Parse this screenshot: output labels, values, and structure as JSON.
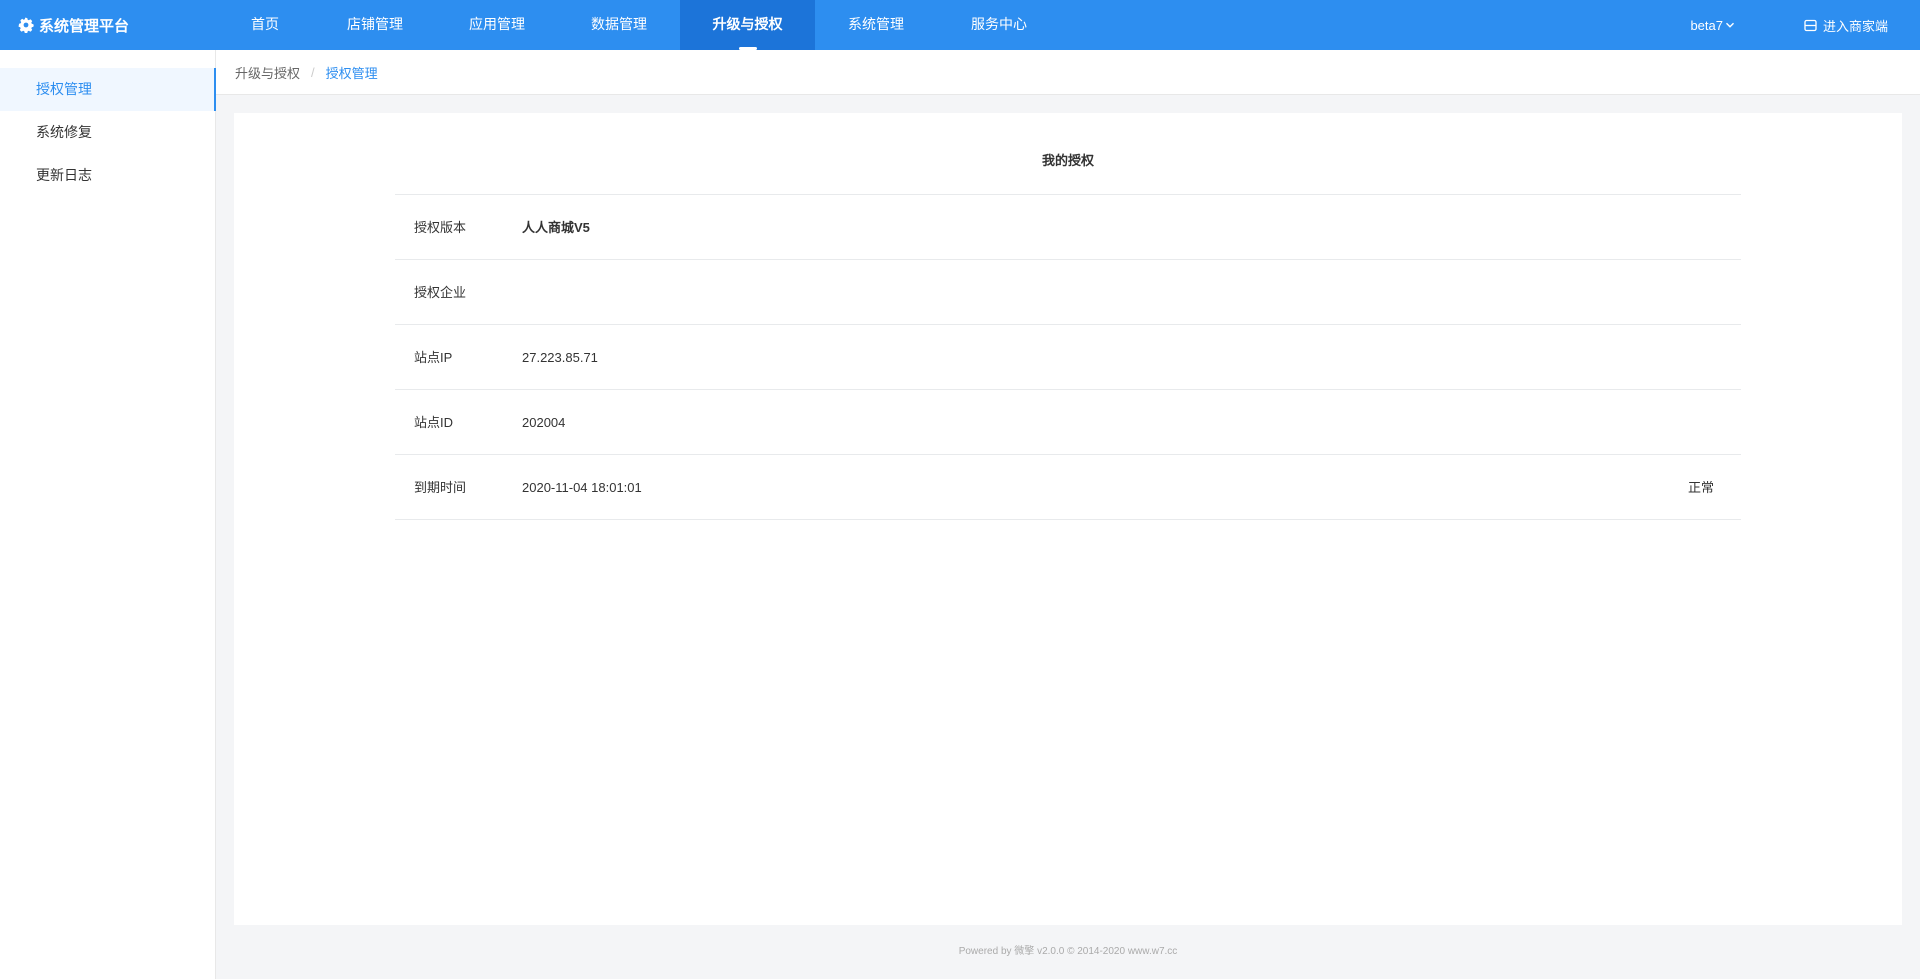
{
  "app": {
    "title": "系统管理平台"
  },
  "nav": {
    "items": [
      {
        "label": "首页"
      },
      {
        "label": "店铺管理"
      },
      {
        "label": "应用管理"
      },
      {
        "label": "数据管理"
      },
      {
        "label": "升级与授权"
      },
      {
        "label": "系统管理"
      },
      {
        "label": "服务中心"
      }
    ],
    "active_index": 4,
    "user": "beta7",
    "enter_label": "进入商家端"
  },
  "sidebar": {
    "items": [
      {
        "label": "授权管理"
      },
      {
        "label": "系统修复"
      },
      {
        "label": "更新日志"
      }
    ],
    "active_index": 0
  },
  "breadcrumb": {
    "parent": "升级与授权",
    "separator": "/",
    "current": "授权管理"
  },
  "main": {
    "title": "我的授权",
    "rows": [
      {
        "label": "授权版本",
        "value": "人人商城V5"
      },
      {
        "label": "授权企业",
        "value": ""
      },
      {
        "label": "站点IP",
        "value": "27.223.85.71"
      },
      {
        "label": "站点ID",
        "value": "202004"
      },
      {
        "label": "到期时间",
        "value": "2020-11-04 18:01:01",
        "status": "正常"
      }
    ]
  },
  "footer": {
    "text": "Powered by 微擎 v2.0.0 © 2014-2020 www.w7.cc"
  },
  "colors": {
    "primary": "#2d8ef0",
    "nav_active": "#1c74d9",
    "background": "#f4f5f7"
  },
  "icons": {
    "brand": "gear-icon",
    "user_dropdown": "chevron-down-icon",
    "enter": "store-icon"
  }
}
